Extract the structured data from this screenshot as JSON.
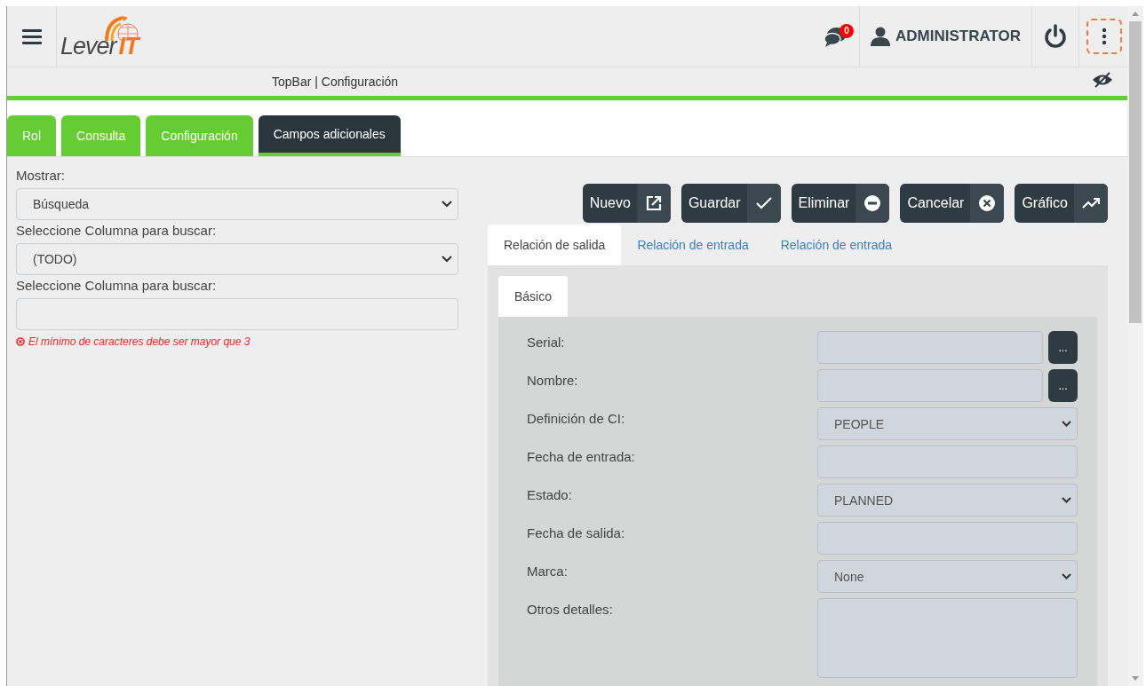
{
  "header": {
    "logo": {
      "text": "Lever",
      "accent": "IT"
    },
    "notifications": {
      "count": "0"
    },
    "user": "ADMINISTRATOR"
  },
  "breadcrumb": {
    "text": "TopBar | Configuración"
  },
  "tabs": [
    {
      "label": "Rol",
      "selected": false
    },
    {
      "label": "Consulta",
      "selected": false
    },
    {
      "label": "Configuración",
      "selected": false
    },
    {
      "label": "Campos adicionales",
      "selected": true
    }
  ],
  "filters": [
    {
      "label": "Mostrar:",
      "kind": "select",
      "value": "Búsqueda"
    },
    {
      "label": "Seleccione Columna para buscar:",
      "kind": "select",
      "value": "(TODO)"
    },
    {
      "label": "Seleccione Columna para buscar:",
      "kind": "text"
    }
  ],
  "error": "El mínimo de caracteres debe ser mayor que 3",
  "actions": [
    {
      "label": "Nuevo",
      "kind": "new"
    },
    {
      "label": "Guardar",
      "kind": "save"
    },
    {
      "label": "Eliminar",
      "kind": "delete"
    },
    {
      "label": "Cancelar",
      "kind": "cancel"
    },
    {
      "label": "Gráfico",
      "kind": "chart"
    }
  ],
  "relation_tabs": [
    {
      "label": "Relación de salida",
      "selected": true
    },
    {
      "label": "Relación de entrada",
      "selected": false
    },
    {
      "label": "Relación de entrada",
      "selected": false
    }
  ],
  "sub_tabs": [
    {
      "label": "Básico",
      "selected": true
    }
  ],
  "fields": [
    {
      "label": "Serial:",
      "kind": "lookup",
      "button": "..."
    },
    {
      "label": "Nombre:",
      "kind": "lookup",
      "button": "..."
    },
    {
      "label": "Definición de CI:",
      "kind": "select",
      "value": "PEOPLE"
    },
    {
      "label": "Fecha de entrada:",
      "kind": "text"
    },
    {
      "label": "Estado:",
      "kind": "select",
      "value": "PLANNED"
    },
    {
      "label": "Fecha de salida:",
      "kind": "text"
    },
    {
      "label": "Marca:",
      "kind": "select",
      "value": "None"
    },
    {
      "label": "Otros detalles:",
      "kind": "textarea"
    }
  ]
}
